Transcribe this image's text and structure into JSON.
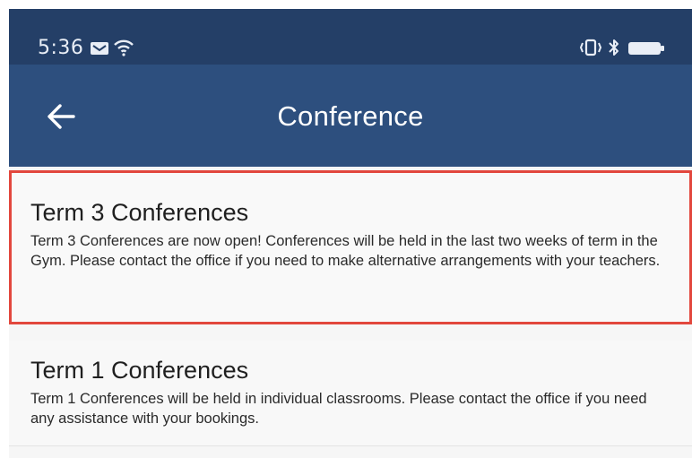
{
  "status_bar": {
    "time": "5:36",
    "left_icons": [
      "message-icon",
      "wifi-icon"
    ],
    "right_icons": [
      "vibrate-icon",
      "bluetooth-icon",
      "battery-icon"
    ]
  },
  "app_bar": {
    "back_icon": "arrow-left-icon",
    "title": "Conference",
    "background": "#2d4f7e"
  },
  "conferences": [
    {
      "title": "Term 3 Conferences",
      "body": "Term 3 Conferences are now open! Conferences will be held in the last two weeks of term in the Gym. Please contact the office if you need to make alternative arrangements with your teachers.",
      "selected": true
    },
    {
      "title": "Term 1 Conferences",
      "body": "Term 1 Conferences will be held in individual classrooms. Please contact the office if you need any assistance with your bookings.",
      "selected": false
    }
  ],
  "colors": {
    "status_bar": "#243f67",
    "selection_border": "#e2473d"
  }
}
